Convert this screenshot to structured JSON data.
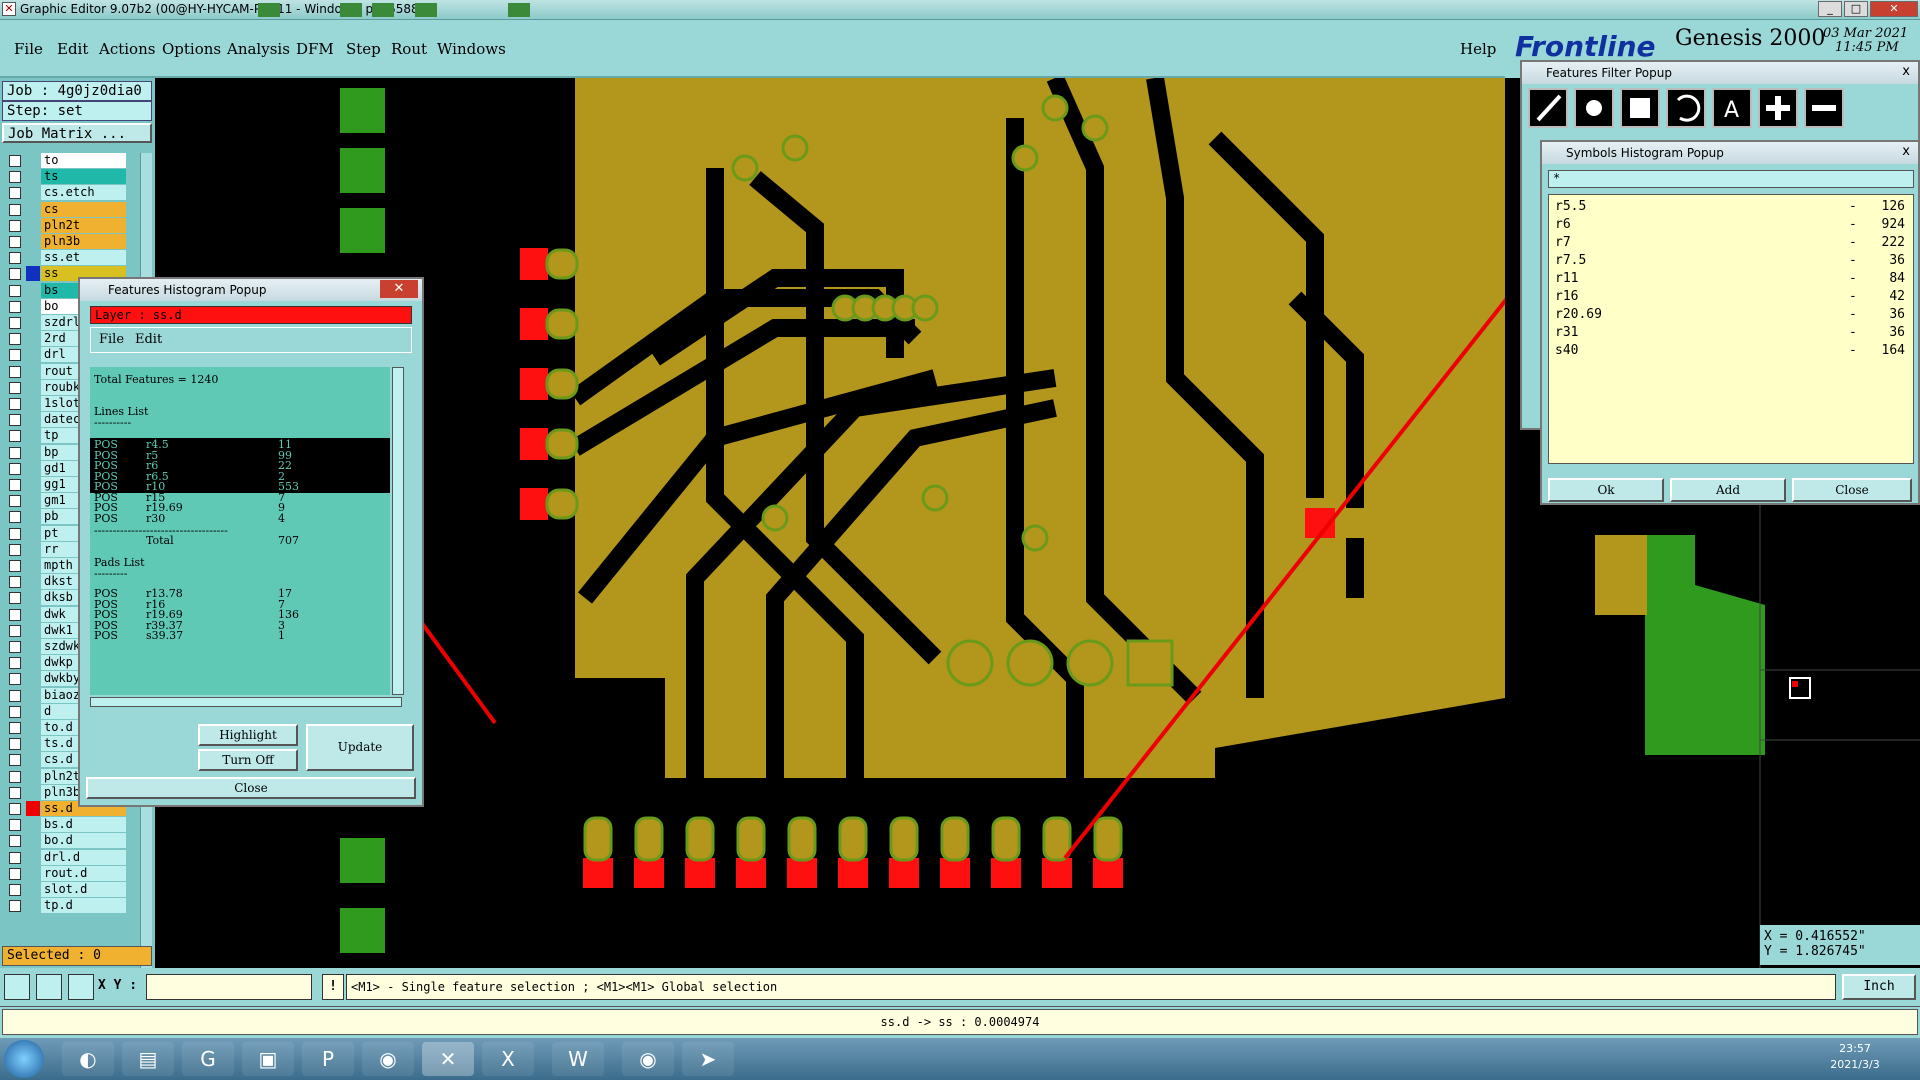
{
  "window": {
    "title": "Graphic Editor 9.07b2 (00@HY-HYCAM-PC411 - Windows, pid:5588)"
  },
  "menu": [
    "File",
    "Edit",
    "Actions",
    "Options",
    "Analysis",
    "DFM",
    "Step",
    "Rout",
    "Windows"
  ],
  "help_label": "Help",
  "brand": {
    "logo": "Frontline",
    "product": "Genesis 2000",
    "date": "03 Mar 2021",
    "time": "11:45 PM"
  },
  "job": {
    "job_line": "Job : 4g0jz0dia0",
    "step_line": "Step: set",
    "matrix_button": "Job Matrix ..."
  },
  "layers": [
    {
      "name": "to",
      "color": "#ffffff"
    },
    {
      "name": "ts",
      "color": "#20b8a8"
    },
    {
      "name": "cs.etch",
      "color": "#bff0f0"
    },
    {
      "name": "cs",
      "color": "#f0b030"
    },
    {
      "name": "pln2t",
      "color": "#f0b030"
    },
    {
      "name": "pln3b",
      "color": "#f0b030"
    },
    {
      "name": "ss.et",
      "color": "#bff0f0"
    },
    {
      "name": "ss",
      "color": "#d8c020"
    },
    {
      "name": "bs",
      "color": "#20b8a8"
    },
    {
      "name": "bo",
      "color": "#ffffff"
    },
    {
      "name": "szdrl",
      "color": "#bff0f0"
    },
    {
      "name": "2rd",
      "color": "#bff0f0"
    },
    {
      "name": "drl",
      "color": "#bff0f0"
    },
    {
      "name": "rout",
      "color": "#bff0f0"
    },
    {
      "name": "roubk",
      "color": "#bff0f0"
    },
    {
      "name": "1slot",
      "color": "#bff0f0"
    },
    {
      "name": "datec",
      "color": "#bff0f0"
    },
    {
      "name": "tp",
      "color": "#bff0f0"
    },
    {
      "name": "bp",
      "color": "#bff0f0"
    },
    {
      "name": "gd1",
      "color": "#bff0f0"
    },
    {
      "name": "gg1",
      "color": "#bff0f0"
    },
    {
      "name": "gm1",
      "color": "#bff0f0"
    },
    {
      "name": "pb",
      "color": "#bff0f0"
    },
    {
      "name": "pt",
      "color": "#bff0f0"
    },
    {
      "name": "rr",
      "color": "#bff0f0"
    },
    {
      "name": "mpth",
      "color": "#bff0f0"
    },
    {
      "name": "dkst",
      "color": "#bff0f0"
    },
    {
      "name": "dksb",
      "color": "#bff0f0"
    },
    {
      "name": "dwk",
      "color": "#bff0f0"
    },
    {
      "name": "dwk1",
      "color": "#bff0f0"
    },
    {
      "name": "szdwk",
      "color": "#bff0f0"
    },
    {
      "name": "dwkp",
      "color": "#bff0f0"
    },
    {
      "name": "dwkby",
      "color": "#bff0f0"
    },
    {
      "name": "biaoz",
      "color": "#bff0f0"
    },
    {
      "name": "d",
      "color": "#bff0f0"
    },
    {
      "name": "to.d",
      "color": "#bff0f0"
    },
    {
      "name": "ts.d",
      "color": "#bff0f0"
    },
    {
      "name": "cs.d",
      "color": "#bff0f0"
    },
    {
      "name": "pln2t",
      "color": "#bff0f0"
    },
    {
      "name": "pln3b.d",
      "color": "#bff0f0"
    },
    {
      "name": "ss.d",
      "color": "#f0b030"
    },
    {
      "name": "bs.d",
      "color": "#bff0f0"
    },
    {
      "name": "bo.d",
      "color": "#bff0f0"
    },
    {
      "name": "drl.d",
      "color": "#bff0f0"
    },
    {
      "name": "rout.d",
      "color": "#bff0f0"
    },
    {
      "name": "slot.d",
      "color": "#bff0f0"
    },
    {
      "name": "tp.d",
      "color": "#bff0f0"
    }
  ],
  "selected_label": "Selected : 0",
  "features_popup": {
    "title": "Features Histogram Popup",
    "layer_label": "Layer :  ss.d",
    "menu_file": "File",
    "menu_edit": "Edit",
    "total": "Total Features = 1240",
    "lines_header": "Lines List",
    "sep": "----------",
    "lines": [
      {
        "t": "POS",
        "s": "r4.5",
        "c": "11"
      },
      {
        "t": "POS",
        "s": "r5",
        "c": "99"
      },
      {
        "t": "POS",
        "s": "r6",
        "c": "22"
      },
      {
        "t": "POS",
        "s": "r6.5",
        "c": "2"
      },
      {
        "t": "POS",
        "s": "r10",
        "c": "553"
      },
      {
        "t": "POS",
        "s": "r15",
        "c": "7"
      },
      {
        "t": "POS",
        "s": "r19.69",
        "c": "9"
      },
      {
        "t": "POS",
        "s": "r30",
        "c": "4"
      }
    ],
    "long_sep": "------------------------------------",
    "total_label": "Total",
    "total_value": "707",
    "pads_header": "Pads List",
    "pads_sep": "---------",
    "pads": [
      {
        "t": "POS",
        "s": "r13.78",
        "c": "17"
      },
      {
        "t": "POS",
        "s": "r16",
        "c": "7"
      },
      {
        "t": "POS",
        "s": "r19.69",
        "c": "136"
      },
      {
        "t": "POS",
        "s": "r39.37",
        "c": "3"
      },
      {
        "t": "POS",
        "s": "s39.37",
        "c": "1"
      }
    ],
    "highlight": "Highlight",
    "turn_off": "Turn Off",
    "update": "Update",
    "close": "Close"
  },
  "filter_popup": {
    "title": "Features Filter Popup",
    "close_x": "x"
  },
  "symbols_popup": {
    "title": "Symbols Histogram Popup",
    "filter_value": "*",
    "rows": [
      {
        "s": "r5.5",
        "c": "126"
      },
      {
        "s": "r6",
        "c": "924"
      },
      {
        "s": "r7",
        "c": "222"
      },
      {
        "s": "r7.5",
        "c": "36"
      },
      {
        "s": "r11",
        "c": "84"
      },
      {
        "s": "r16",
        "c": "42"
      },
      {
        "s": "r20.69",
        "c": "36"
      },
      {
        "s": "r31",
        "c": "36"
      },
      {
        "s": "s40",
        "c": "164"
      }
    ],
    "ok": "Ok",
    "add": "Add",
    "close": "Close"
  },
  "coords": {
    "x": "X = 0.416552\"",
    "y": "Y = 1.826745\""
  },
  "status": {
    "xy_label": "X Y :",
    "hint": "<M1> - Single feature selection ; <M1><M1> Global selection",
    "units": "Inch",
    "info": "ss.d -> ss : 0.0004974"
  },
  "taskbar": {
    "time": "23:57",
    "date": "2021/3/3"
  }
}
